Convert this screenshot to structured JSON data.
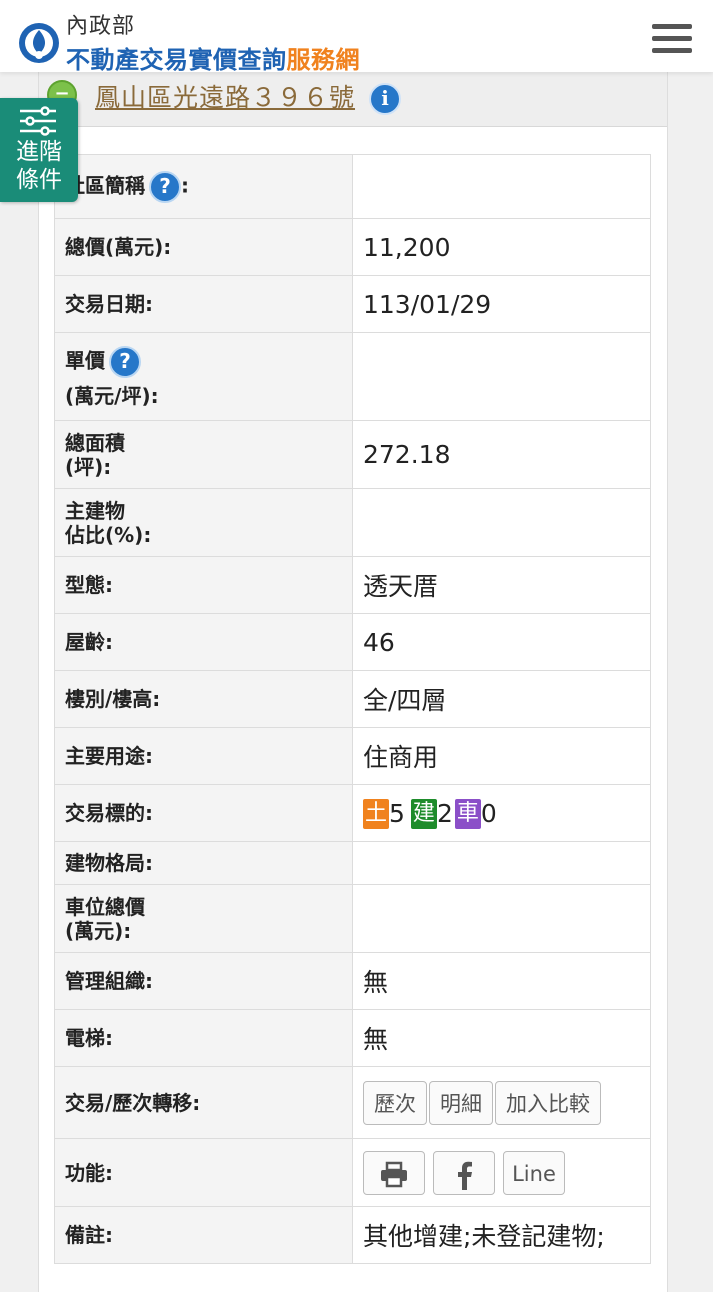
{
  "header": {
    "ministry": "內政部",
    "title_main": "不動產交易實價查詢",
    "title_accent": "服務網",
    "menu_icon": "hamburger-menu-icon"
  },
  "filter_tab": {
    "label_line1": "進階",
    "label_line2": "條件",
    "icon": "sliders-icon"
  },
  "address": {
    "text": "鳳山區光遠路３９６號",
    "collapse_symbol": "−",
    "info_symbol": "i"
  },
  "colors": {
    "brand_blue": "#1f63b3",
    "brand_orange": "#f0821e",
    "filter_green": "#1a8c78",
    "land_tag": "#f0821e",
    "building_tag": "#1e8c2b",
    "parking_tag": "#8b4fc8"
  },
  "rows": {
    "community": {
      "label": "社區簡稱",
      "suffix": ":",
      "help": "?",
      "value": ""
    },
    "total_price": {
      "label": "總價(萬元):",
      "value": "11,200"
    },
    "trade_date": {
      "label": "交易日期:",
      "value": "113/01/29"
    },
    "unit_price": {
      "label1": "單價",
      "label2": "(萬元/坪):",
      "help": "?",
      "value": ""
    },
    "total_area": {
      "label1": "總面積",
      "label2": "(坪):",
      "value": "272.18"
    },
    "main_ratio": {
      "label1": "主建物",
      "label2": "佔比(%):",
      "value": ""
    },
    "type": {
      "label": "型態:",
      "value": "透天厝"
    },
    "age": {
      "label": "屋齡:",
      "value": "46"
    },
    "floor": {
      "label": "樓別/樓高:",
      "value": "全/四層"
    },
    "usage": {
      "label": "主要用途:",
      "value": "住商用"
    },
    "target": {
      "label": "交易標的:",
      "land_tag": "土",
      "land_count": "5",
      "building_tag": "建",
      "building_count": "2",
      "parking_tag": "車",
      "parking_count": "0"
    },
    "layout": {
      "label": "建物格局:",
      "value": ""
    },
    "parking_price": {
      "label1": "車位總價",
      "label2": "(萬元):",
      "value": ""
    },
    "management": {
      "label": "管理組織:",
      "value": "無"
    },
    "elevator": {
      "label": "電梯:",
      "value": "無"
    },
    "history": {
      "label": "交易/歷次轉移:",
      "btn_history": "歷次",
      "btn_detail": "明細",
      "btn_compare": "加入比較"
    },
    "functions": {
      "label": "功能:",
      "print_icon": "printer-icon",
      "facebook_icon": "facebook-icon",
      "btn_line": "Line"
    },
    "remarks": {
      "label": "備註:",
      "value": "其他增建;未登記建物;"
    }
  }
}
